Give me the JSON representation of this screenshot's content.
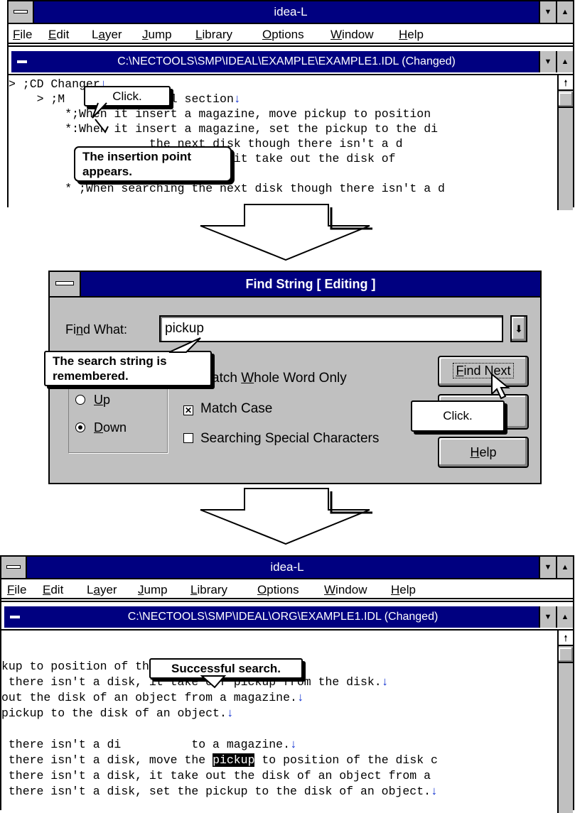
{
  "window1": {
    "title": "idea-L",
    "menu": [
      "File",
      "Edit",
      "Layer",
      "Jump",
      "Library",
      "Options",
      "Window",
      "Help"
    ],
    "doc_title": "C:\\NECTOOLS\\SMP\\IDEAL\\EXAMPLE\\EXAMPLE1.IDL (Changed)",
    "lines": [
      "> ;CD Changer",
      "    > ;M          ontrol section",
      "        *;When it insert a magazine, move pickup to position",
      "        *:When it insert a magazine, set the pickup to the di",
      "                    the next disk though there isn't a d",
      "                    a magazine, it take out the disk of",
      "",
      "        * ;When searching the next disk though there isn't a d"
    ],
    "callout_click": "Click.",
    "callout_insertion": "The insertion point appears."
  },
  "dialog": {
    "title": "Find String [ Editing ]",
    "find_what_label": "Find What:",
    "find_what_value": "pickup",
    "match_whole_word": "Match Whole Word Only",
    "match_case": "Match Case",
    "match_case_checked": true,
    "special_chars": "Searching Special Characters",
    "special_chars_checked": false,
    "direction_up": "Up",
    "direction_down": "Down",
    "direction_selected": "Down",
    "find_next": "Find Next",
    "help": "Help",
    "callout_remembered": "The search string is remembered.",
    "callout_click": "Click."
  },
  "window2": {
    "title": "idea-L",
    "menu": [
      "File",
      "Edit",
      "Layer",
      "Jump",
      "Library",
      "Options",
      "Window",
      "Help"
    ],
    "doc_title": "C:\\NECTOOLS\\SMP\\IDEAL\\ORG\\EXAMPLE1.IDL (Changed)",
    "lines": [
      "kup to position of the first disk.",
      " there isn't a disk, it take off pickup from the disk.",
      "out the disk of an object from a magazine.",
      "pickup to the disk of an object.",
      "",
      " there isn't a di          to a magazine.",
      " there isn't a disk, move the ",
      " there isn't a disk, it take out the disk of an object from a",
      " there isn't a disk, set the pickup to the disk of an object."
    ],
    "highlight_word": "pickup",
    "highlight_rest": " to position of the disk c",
    "callout_success": "Successful search."
  },
  "colors": {
    "titlebar": "#000080",
    "face": "#c0c0c0",
    "return_mark": "#1030d0"
  }
}
